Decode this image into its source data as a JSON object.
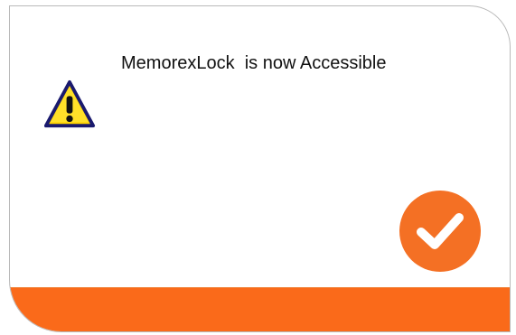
{
  "dialog": {
    "message": "MemorexLock  is now Accessible",
    "warning_icon": "warning-triangle-icon",
    "ok_icon": "checkmark-icon"
  },
  "colors": {
    "accent": "#f47024",
    "bottom_bar": "#fa6a1a",
    "warning_fill": "#ffd400",
    "warning_outline": "#1a1a6e"
  }
}
